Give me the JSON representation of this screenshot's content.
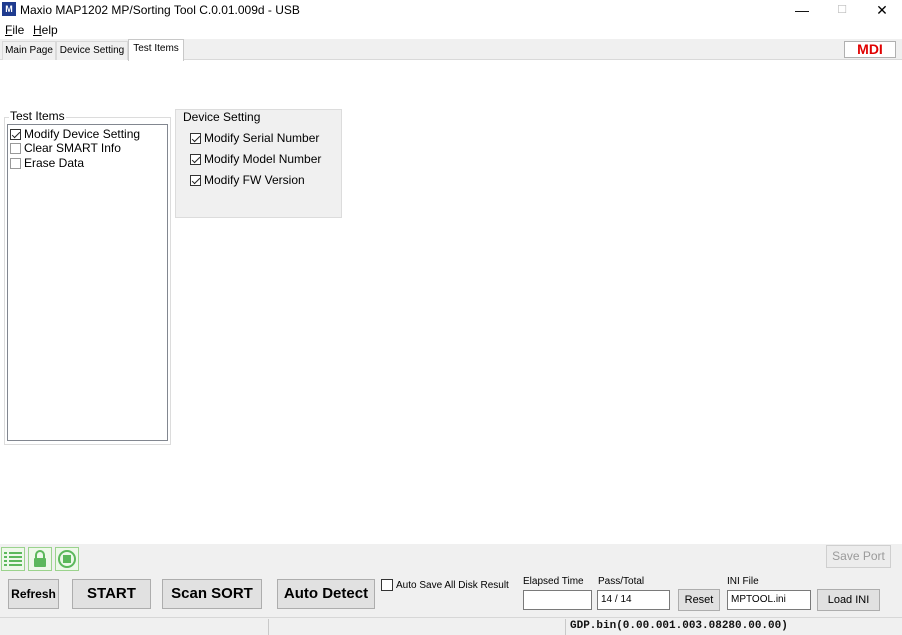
{
  "window": {
    "title": "Maxio MAP1202 MP/Sorting Tool C.0.01.009d - USB",
    "app_icon_letter": "M",
    "controls": {
      "minimize": "—",
      "maximize": "☐",
      "close": "✕"
    }
  },
  "menu": [
    {
      "label": "File",
      "accel": "F",
      "rest": "ile"
    },
    {
      "label": "Help",
      "accel": "H",
      "rest": "elp"
    }
  ],
  "tabs": [
    {
      "label": "Main Page",
      "active": false
    },
    {
      "label": "Device Setting",
      "active": false
    },
    {
      "label": "Test Items",
      "active": true
    }
  ],
  "mdi_label": "MDI",
  "test_items": {
    "title": "Test Items",
    "items": [
      {
        "label": "Modify Device Setting",
        "checked": true
      },
      {
        "label": "Clear SMART Info",
        "checked": false
      },
      {
        "label": "Erase Data",
        "checked": false
      }
    ]
  },
  "device_setting": {
    "title": "Device Setting",
    "options": [
      {
        "label": "Modify Serial Number",
        "checked": true
      },
      {
        "label": "Modify Model Number",
        "checked": true
      },
      {
        "label": "Modify FW Version",
        "checked": true
      }
    ]
  },
  "toolbar_icons": [
    "list-icon",
    "lock-icon",
    "stop-icon"
  ],
  "save_port_label": "Save Port",
  "buttons": {
    "refresh": "Refresh",
    "start": "START",
    "scan_sort": "Scan SORT",
    "auto_detect": "Auto Detect",
    "reset": "Reset",
    "load_ini": "Load INI"
  },
  "auto_save": {
    "label": "Auto Save All Disk Result",
    "checked": false
  },
  "elapsed_time": {
    "label": "Elapsed Time",
    "value": ""
  },
  "pass_total": {
    "label": "Pass/Total",
    "value": "14 / 14"
  },
  "ini_file": {
    "label": "INI File",
    "value": "MPTOOL.ini"
  },
  "status": {
    "text": "GDP.bin(0.00.001.003.08280.00.00)"
  },
  "colors": {
    "mdi": "#e00000",
    "app_icon_bg": "#1f3b8f",
    "icon_green": "#5cb85c"
  }
}
